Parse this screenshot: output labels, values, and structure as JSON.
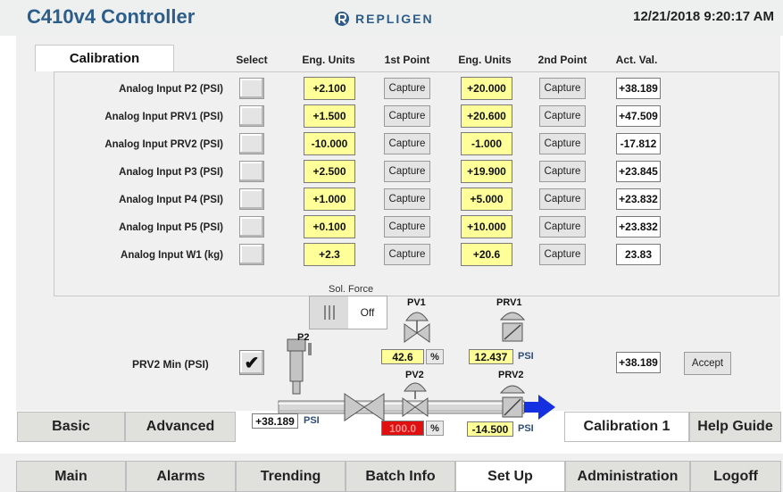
{
  "header": {
    "title": "C410v4 Controller",
    "brand": "REPLIGEN",
    "datetime": "12/21/2018 9:20:17 AM",
    "brand_color": "#2d5d8a"
  },
  "calibration": {
    "tab_label": "Calibration",
    "columns": [
      "Select",
      "Eng. Units",
      "1st Point",
      "Eng. Units",
      "2nd Point",
      "Act. Val."
    ],
    "rows": [
      {
        "label": "Analog Input P2 (PSI)",
        "eng1": "+2.100",
        "cap1": "Capture",
        "eng2": "+20.000",
        "cap2": "Capture",
        "act": "+38.189"
      },
      {
        "label": "Analog Input PRV1 (PSI)",
        "eng1": "+1.500",
        "cap1": "Capture",
        "eng2": "+20.600",
        "cap2": "Capture",
        "act": "+47.509"
      },
      {
        "label": "Analog Input PRV2 (PSI)",
        "eng1": "-10.000",
        "cap1": "Capture",
        "eng2": "-1.000",
        "cap2": "Capture",
        "act": "-17.812"
      },
      {
        "label": "Analog Input P3 (PSI)",
        "eng1": "+2.500",
        "cap1": "Capture",
        "eng2": "+19.900",
        "cap2": "Capture",
        "act": "+23.845"
      },
      {
        "label": "Analog Input P4 (PSI)",
        "eng1": "+1.000",
        "cap1": "Capture",
        "eng2": "+5.000",
        "cap2": "Capture",
        "act": "+23.832"
      },
      {
        "label": "Analog Input P5 (PSI)",
        "eng1": "+0.100",
        "cap1": "Capture",
        "eng2": "+10.000",
        "cap2": "Capture",
        "act": "+23.832"
      },
      {
        "label": "Analog Input W1 (kg)",
        "eng1": "+2.3",
        "cap1": "Capture",
        "eng2": "+20.6",
        "cap2": "Capture",
        "act": "23.83"
      }
    ]
  },
  "process": {
    "sol_force_label": "Sol. Force",
    "sol_force_state": "Off",
    "p2_label": "P2",
    "p2_value": "+38.189",
    "p2_unit": "PSI",
    "pv1_label": "PV1",
    "pv1_value": "42.6",
    "pv1_unit": "%",
    "prv1_label": "PRV1",
    "prv1_value": "12.437",
    "prv1_unit": "PSI",
    "pv2_label": "PV2",
    "pv2_value": "100.0",
    "pv2_unit": "%",
    "prv2_label": "PRV2",
    "prv2_value": "-14.500",
    "prv2_unit": "PSI",
    "prv2_min_label": "PRV2 Min (PSI)",
    "prv2_min_checked": "✔",
    "prv2_min_value": "+38.189",
    "accept_label": "Accept",
    "pv2_alarm_color": "#e01010",
    "flow_color": "#1530e0"
  },
  "subtabs": {
    "basic": "Basic",
    "advanced": "Advanced",
    "calibration1": "Calibration 1",
    "help": "Help Guide"
  },
  "nav": [
    {
      "label": "Main"
    },
    {
      "label": "Alarms"
    },
    {
      "label": "Trending"
    },
    {
      "label": "Batch Info"
    },
    {
      "label": "Set Up"
    },
    {
      "label": "Administration"
    },
    {
      "label": "Logoff"
    }
  ],
  "icons": {
    "brand_logo": "repligen-logo-icon",
    "switch": "toggle-bars-icon",
    "check": "checkmark-icon"
  }
}
